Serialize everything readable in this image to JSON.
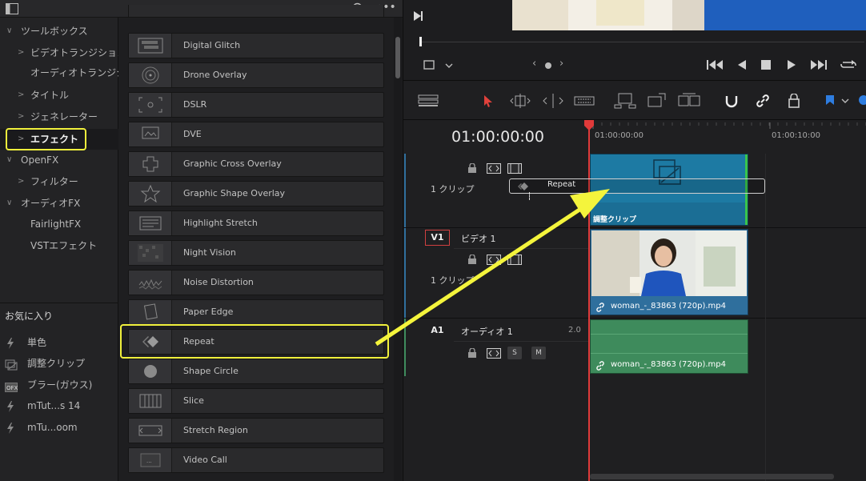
{
  "tree": {
    "items": [
      {
        "label": "ツールボックス",
        "arrow": "∨",
        "indent": 0,
        "selected": false
      },
      {
        "label": "ビデオトランジション",
        "arrow": ">",
        "indent": 1,
        "selected": false
      },
      {
        "label": "オーディオトランジシ…",
        "arrow": "",
        "indent": 1,
        "selected": false
      },
      {
        "label": "タイトル",
        "arrow": ">",
        "indent": 1,
        "selected": false
      },
      {
        "label": "ジェネレーター",
        "arrow": ">",
        "indent": 1,
        "selected": false
      },
      {
        "label": "エフェクト",
        "arrow": ">",
        "indent": 1,
        "selected": true
      },
      {
        "label": "OpenFX",
        "arrow": "∨",
        "indent": 0,
        "selected": false
      },
      {
        "label": "フィルター",
        "arrow": ">",
        "indent": 1,
        "selected": false
      },
      {
        "label": "オーディオFX",
        "arrow": "∨",
        "indent": 0,
        "selected": false
      },
      {
        "label": "FairlightFX",
        "arrow": "",
        "indent": 1,
        "selected": false
      },
      {
        "label": "VSTエフェクト",
        "arrow": "",
        "indent": 1,
        "selected": false
      }
    ]
  },
  "favorites": {
    "title": "お気に入り",
    "items": [
      {
        "label": "単色",
        "icon": "lightning-icon"
      },
      {
        "label": "調整クリップ",
        "icon": "adjustment-clip-icon"
      },
      {
        "label": "ブラー(ガウス)",
        "icon": "ofx-icon"
      },
      {
        "label": "mTut...s 14",
        "icon": "lightning-icon"
      },
      {
        "label": "mTu...oom",
        "icon": "lightning-icon"
      }
    ]
  },
  "effects": {
    "items": [
      {
        "label": "Digital Glitch"
      },
      {
        "label": "Drone Overlay"
      },
      {
        "label": "DSLR"
      },
      {
        "label": "DVE"
      },
      {
        "label": "Graphic Cross Overlay"
      },
      {
        "label": "Graphic Shape Overlay"
      },
      {
        "label": "Highlight Stretch"
      },
      {
        "label": "Night Vision"
      },
      {
        "label": "Noise Distortion"
      },
      {
        "label": "Paper Edge"
      },
      {
        "label": "Repeat"
      },
      {
        "label": "Shape Circle"
      },
      {
        "label": "Slice"
      },
      {
        "label": "Stretch Region"
      },
      {
        "label": "Video Call"
      }
    ],
    "highlighted": "Repeat"
  },
  "timeline": {
    "timecode": "01:00:00:00",
    "ruler": [
      "01:00:00:00",
      "01:00:10:00"
    ],
    "track_v2": {
      "clips_label": "1 クリップ",
      "clip_label": "調整クリップ",
      "drag_label": "Repeat"
    },
    "track_v1": {
      "id": "V1",
      "name": "ビデオ 1",
      "clips_label": "1 クリップ",
      "clip_file": "woman_-_83863 (720p).mp4"
    },
    "track_a1": {
      "id": "A1",
      "name": "オーディオ 1",
      "channels": "2.0",
      "solo": "S",
      "mute": "M",
      "clip_file": "woman_-_83863 (720p).mp4"
    }
  },
  "colors": {
    "highlight_yellow": "#f0f03c",
    "video_clip": "#2f6f9d",
    "audio_clip": "#3e8b5c",
    "adjust_clip": "#1d7aa3",
    "playhead": "#e03a3a",
    "clip_green": "#3ac44c"
  }
}
